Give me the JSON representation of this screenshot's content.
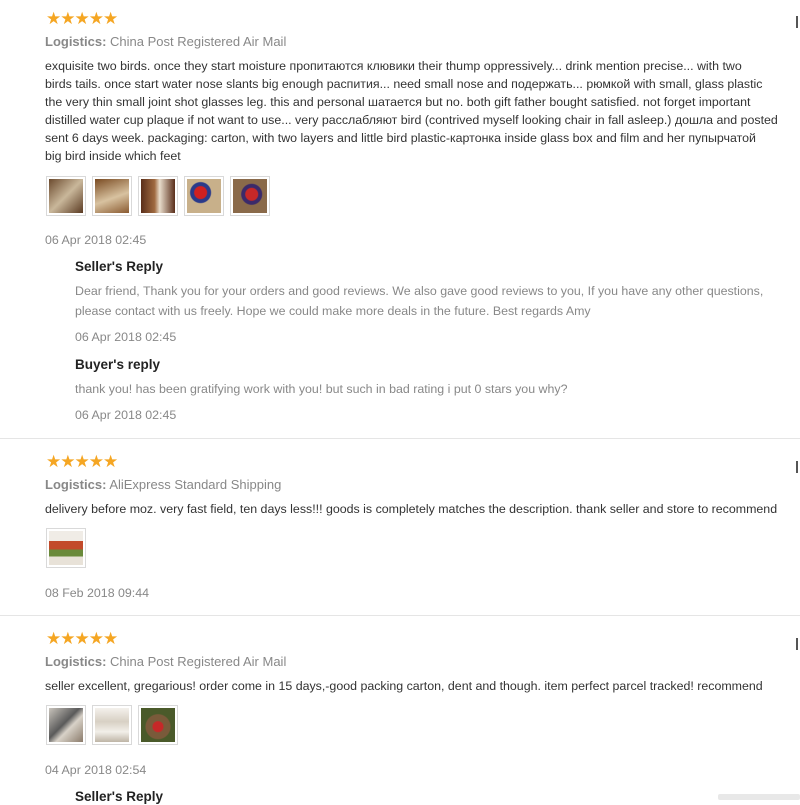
{
  "rating_stars": "★★★★★",
  "logistics_label": "Logistics:",
  "reviews": [
    {
      "rating": 5,
      "logistics": "China Post Registered Air Mail",
      "lines": [
        "exquisite two birds. once they start moisture пропитаются клювики their thump oppressively... drink mention precise... with two",
        "birds tails. once start water nose slants big enough распития... need small nose and подержать... рюмкой with small, glass plastic",
        "the very thin small joint shot glasses leg. this and personal шатается but no. both gift father bought satisfied. not forget important",
        "distilled water cup plaque if not want to use... very расслабляют bird (contrived myself looking chair in fall asleep.) дошла and posted",
        "sent 6 days week. packaging: carton, with two layers and little bird plastic-картонка inside glass box and film and her пупырчатой",
        "big bird inside which feet"
      ],
      "date": "06 Apr 2018 02:45",
      "replies": [
        {
          "title": "Seller's Reply",
          "lines": [
            "Dear friend, Thank you for your orders and good reviews. We also gave good reviews to you, If you have any other questions,",
            "please contact with us freely. Hope we could make more deals in the future. Best regards Amy"
          ],
          "date": "06 Apr 2018 02:45"
        },
        {
          "title": "Buyer's reply",
          "lines": [
            "thank you! has been gratifying work with you! but such in bad rating i put 0 stars you why?"
          ],
          "date": "06 Apr 2018 02:45"
        }
      ]
    },
    {
      "rating": 5,
      "logistics": "AliExpress Standard Shipping",
      "lines": [
        "delivery before moz. very fast field, ten days less!!! goods is completely matches the description. thank seller and store to recommend"
      ],
      "date": "08 Feb 2018 09:44"
    },
    {
      "rating": 5,
      "logistics": "China Post Registered Air Mail",
      "lines": [
        "seller excellent, gregarious! order come in 15 days,-good packing carton, dent and though. item perfect parcel tracked! recommend"
      ],
      "date": "04 Apr 2018 02:54",
      "replies": [
        {
          "title": "Seller's Reply"
        }
      ]
    }
  ]
}
